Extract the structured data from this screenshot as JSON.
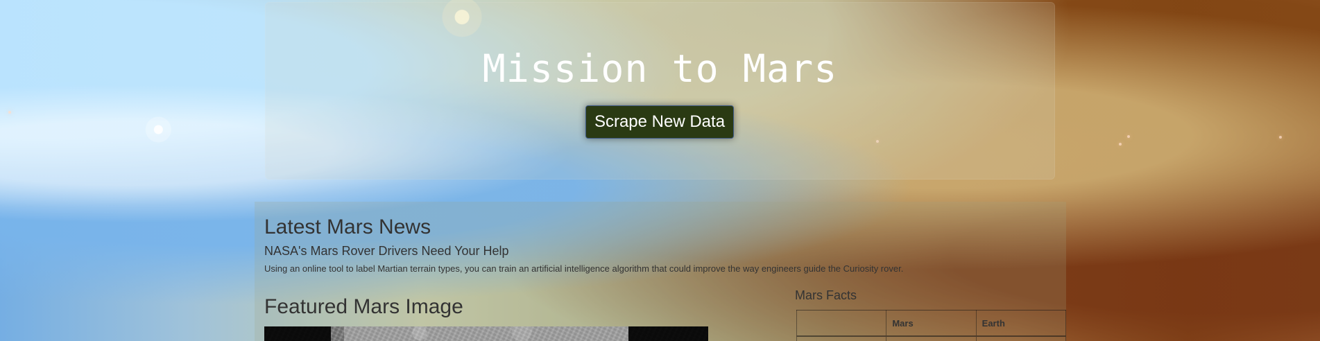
{
  "hero": {
    "title": "Mission to Mars",
    "scrape_button_label": "Scrape New Data"
  },
  "news": {
    "section_title": "Latest Mars News",
    "headline": "NASA's Mars Rover Drivers Need Your Help",
    "paragraph": "Using an online tool to label Martian terrain types, you can train an artificial intelligence algorithm that could improve the way engineers guide the Curiosity rover."
  },
  "featured_image": {
    "section_title": "Featured Mars Image"
  },
  "mars_facts": {
    "section_title": "Mars Facts",
    "table": {
      "headers": [
        "",
        "Mars",
        "Earth"
      ]
    }
  },
  "colors": {
    "button_background": "#2a3a13",
    "button_border": "#3f5a86",
    "hero_text": "#ffffff",
    "content_text": "#333333"
  }
}
